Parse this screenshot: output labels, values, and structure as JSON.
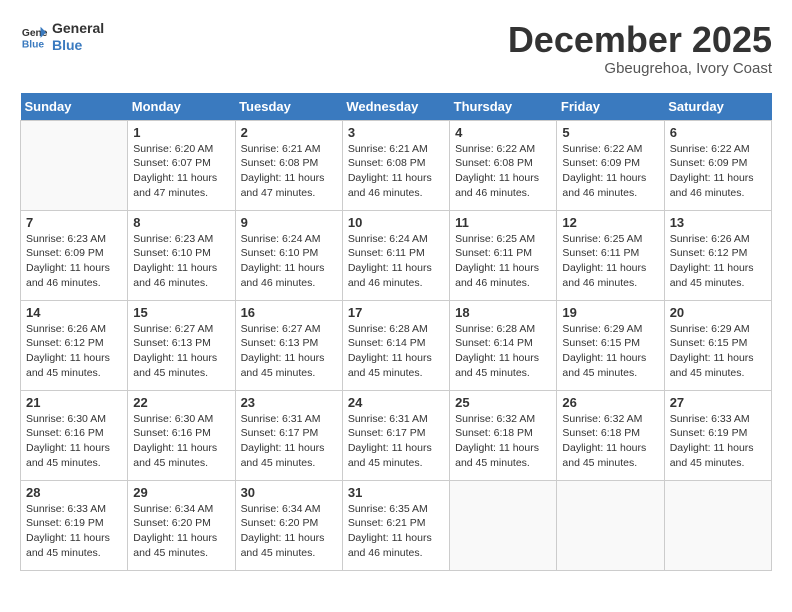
{
  "header": {
    "logo": {
      "line1": "General",
      "line2": "Blue"
    },
    "title": "December 2025",
    "subtitle": "Gbeugrehoa, Ivory Coast"
  },
  "days_of_week": [
    "Sunday",
    "Monday",
    "Tuesday",
    "Wednesday",
    "Thursday",
    "Friday",
    "Saturday"
  ],
  "weeks": [
    [
      {
        "day": "",
        "info": ""
      },
      {
        "day": "1",
        "info": "Sunrise: 6:20 AM\nSunset: 6:07 PM\nDaylight: 11 hours and 47 minutes."
      },
      {
        "day": "2",
        "info": "Sunrise: 6:21 AM\nSunset: 6:08 PM\nDaylight: 11 hours and 47 minutes."
      },
      {
        "day": "3",
        "info": "Sunrise: 6:21 AM\nSunset: 6:08 PM\nDaylight: 11 hours and 46 minutes."
      },
      {
        "day": "4",
        "info": "Sunrise: 6:22 AM\nSunset: 6:08 PM\nDaylight: 11 hours and 46 minutes."
      },
      {
        "day": "5",
        "info": "Sunrise: 6:22 AM\nSunset: 6:09 PM\nDaylight: 11 hours and 46 minutes."
      },
      {
        "day": "6",
        "info": "Sunrise: 6:22 AM\nSunset: 6:09 PM\nDaylight: 11 hours and 46 minutes."
      }
    ],
    [
      {
        "day": "7",
        "info": "Sunrise: 6:23 AM\nSunset: 6:09 PM\nDaylight: 11 hours and 46 minutes."
      },
      {
        "day": "8",
        "info": "Sunrise: 6:23 AM\nSunset: 6:10 PM\nDaylight: 11 hours and 46 minutes."
      },
      {
        "day": "9",
        "info": "Sunrise: 6:24 AM\nSunset: 6:10 PM\nDaylight: 11 hours and 46 minutes."
      },
      {
        "day": "10",
        "info": "Sunrise: 6:24 AM\nSunset: 6:11 PM\nDaylight: 11 hours and 46 minutes."
      },
      {
        "day": "11",
        "info": "Sunrise: 6:25 AM\nSunset: 6:11 PM\nDaylight: 11 hours and 46 minutes."
      },
      {
        "day": "12",
        "info": "Sunrise: 6:25 AM\nSunset: 6:11 PM\nDaylight: 11 hours and 46 minutes."
      },
      {
        "day": "13",
        "info": "Sunrise: 6:26 AM\nSunset: 6:12 PM\nDaylight: 11 hours and 45 minutes."
      }
    ],
    [
      {
        "day": "14",
        "info": "Sunrise: 6:26 AM\nSunset: 6:12 PM\nDaylight: 11 hours and 45 minutes."
      },
      {
        "day": "15",
        "info": "Sunrise: 6:27 AM\nSunset: 6:13 PM\nDaylight: 11 hours and 45 minutes."
      },
      {
        "day": "16",
        "info": "Sunrise: 6:27 AM\nSunset: 6:13 PM\nDaylight: 11 hours and 45 minutes."
      },
      {
        "day": "17",
        "info": "Sunrise: 6:28 AM\nSunset: 6:14 PM\nDaylight: 11 hours and 45 minutes."
      },
      {
        "day": "18",
        "info": "Sunrise: 6:28 AM\nSunset: 6:14 PM\nDaylight: 11 hours and 45 minutes."
      },
      {
        "day": "19",
        "info": "Sunrise: 6:29 AM\nSunset: 6:15 PM\nDaylight: 11 hours and 45 minutes."
      },
      {
        "day": "20",
        "info": "Sunrise: 6:29 AM\nSunset: 6:15 PM\nDaylight: 11 hours and 45 minutes."
      }
    ],
    [
      {
        "day": "21",
        "info": "Sunrise: 6:30 AM\nSunset: 6:16 PM\nDaylight: 11 hours and 45 minutes."
      },
      {
        "day": "22",
        "info": "Sunrise: 6:30 AM\nSunset: 6:16 PM\nDaylight: 11 hours and 45 minutes."
      },
      {
        "day": "23",
        "info": "Sunrise: 6:31 AM\nSunset: 6:17 PM\nDaylight: 11 hours and 45 minutes."
      },
      {
        "day": "24",
        "info": "Sunrise: 6:31 AM\nSunset: 6:17 PM\nDaylight: 11 hours and 45 minutes."
      },
      {
        "day": "25",
        "info": "Sunrise: 6:32 AM\nSunset: 6:18 PM\nDaylight: 11 hours and 45 minutes."
      },
      {
        "day": "26",
        "info": "Sunrise: 6:32 AM\nSunset: 6:18 PM\nDaylight: 11 hours and 45 minutes."
      },
      {
        "day": "27",
        "info": "Sunrise: 6:33 AM\nSunset: 6:19 PM\nDaylight: 11 hours and 45 minutes."
      }
    ],
    [
      {
        "day": "28",
        "info": "Sunrise: 6:33 AM\nSunset: 6:19 PM\nDaylight: 11 hours and 45 minutes."
      },
      {
        "day": "29",
        "info": "Sunrise: 6:34 AM\nSunset: 6:20 PM\nDaylight: 11 hours and 45 minutes."
      },
      {
        "day": "30",
        "info": "Sunrise: 6:34 AM\nSunset: 6:20 PM\nDaylight: 11 hours and 45 minutes."
      },
      {
        "day": "31",
        "info": "Sunrise: 6:35 AM\nSunset: 6:21 PM\nDaylight: 11 hours and 46 minutes."
      },
      {
        "day": "",
        "info": ""
      },
      {
        "day": "",
        "info": ""
      },
      {
        "day": "",
        "info": ""
      }
    ]
  ]
}
